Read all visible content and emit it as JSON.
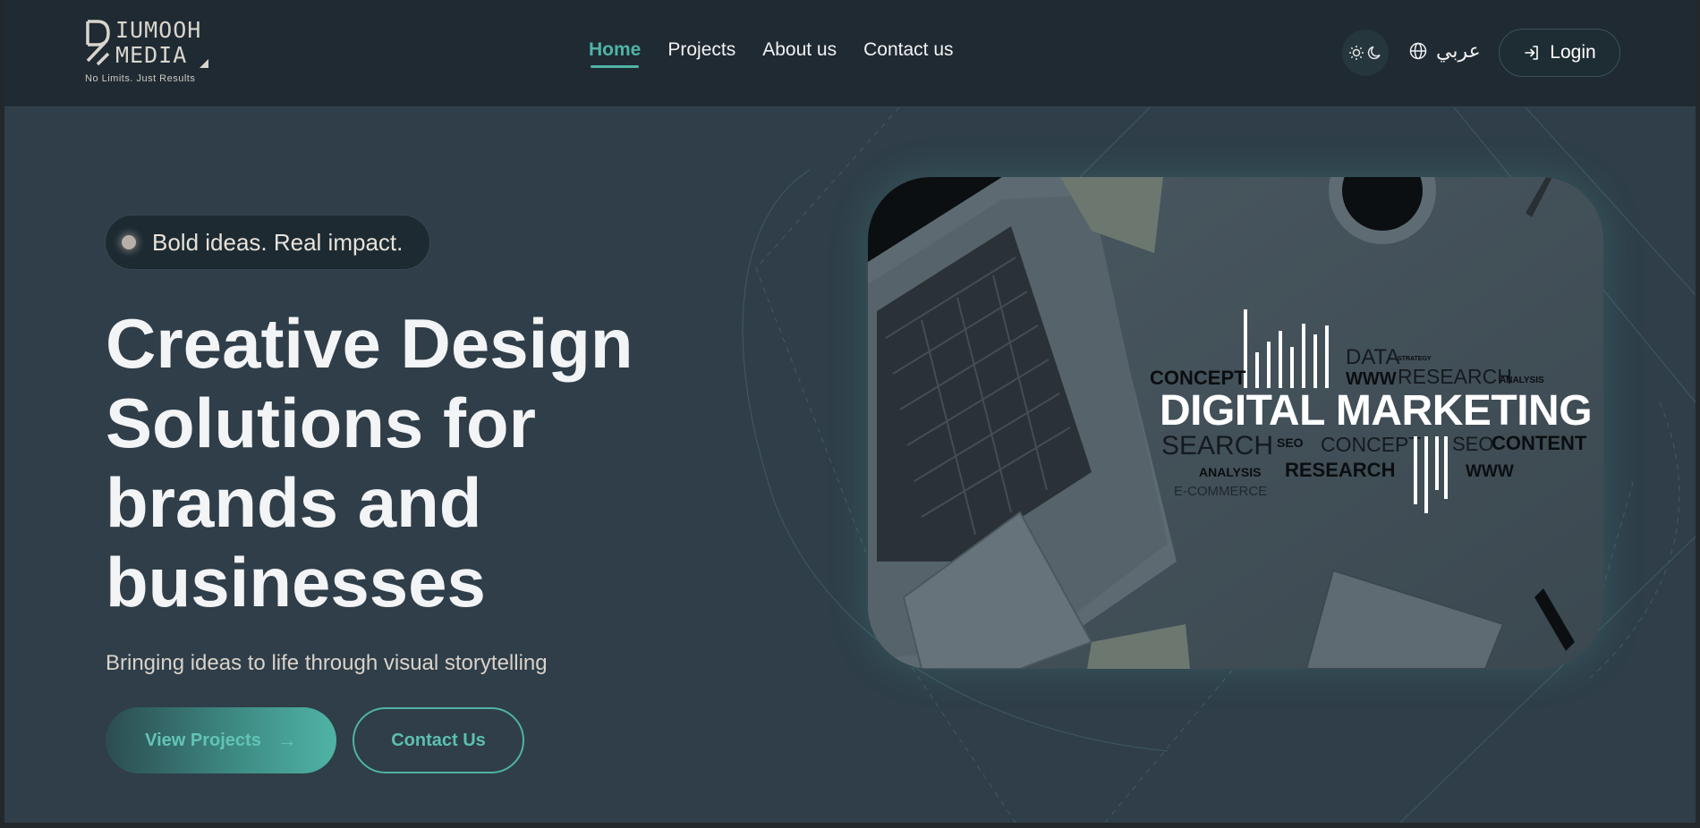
{
  "header": {
    "logo": {
      "line1": "IUMOOH",
      "line2": "MEDIA",
      "tagline": "No Limits. Just Results"
    },
    "nav": [
      {
        "label": "Home",
        "active": true
      },
      {
        "label": "Projects",
        "active": false
      },
      {
        "label": "About us",
        "active": false
      },
      {
        "label": "Contact us",
        "active": false
      }
    ],
    "language_label": "عربي",
    "login_label": "Login"
  },
  "hero": {
    "badge": "Bold ideas. Real impact.",
    "title_lines": [
      "Creative Design",
      "Solutions for",
      "brands and",
      "businesses"
    ],
    "subtitle": "Bringing ideas to life through visual storytelling",
    "primary_button": "View Projects",
    "secondary_button": "Contact Us",
    "image": {
      "headline": "DIGITAL MARKETING",
      "words": [
        "DATA",
        "STRATEGY",
        "CONCEPT",
        "WWW",
        "RESEARCH",
        "ANALYSIS",
        "SEARCH",
        "SEO",
        "CONCEPT",
        "SEO",
        "CONTENT",
        "ANALYSIS",
        "RESEARCH",
        "WWW",
        "E-COMMERCE"
      ]
    }
  },
  "colors": {
    "accent": "#4fb3a6",
    "header_bg": "#1f2a33",
    "page_bg": "#2f3e48",
    "text": "#f3f4f6"
  },
  "icons": [
    "logo-mark-icon",
    "sun-icon",
    "moon-icon",
    "globe-icon",
    "login-icon",
    "arrow-right-icon"
  ]
}
